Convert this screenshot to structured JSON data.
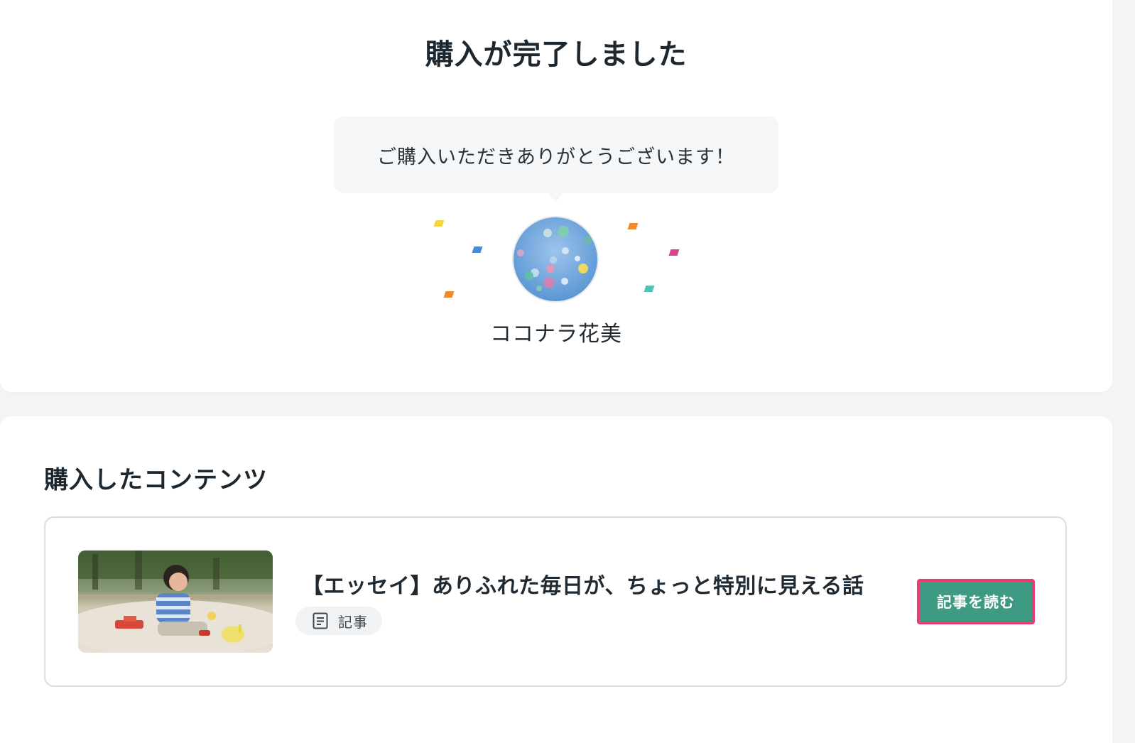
{
  "header": {
    "title": "購入が完了しました"
  },
  "thanks": {
    "message": "ご購入いただきありがとうございます！"
  },
  "author": {
    "name": "ココナラ花美",
    "avatar_icon": "balloons-photo"
  },
  "confetti_colors": [
    "#f5d63c",
    "#3f8fe0",
    "#ee8c2a",
    "#ef8a2e",
    "#d9448c",
    "#4fc4b2"
  ],
  "purchased": {
    "section_title": "購入したコンテンツ",
    "items": [
      {
        "title": "【エッセイ】ありふれた毎日が、ちょっと特別に見える話",
        "type_label": "記事",
        "type_icon": "document-icon",
        "thumbnail": "child-in-sandbox-photo",
        "button_label": "記事を読む"
      }
    ]
  },
  "colors": {
    "button": "#3e9b83",
    "button_highlight": "#e63c73",
    "background": "#f3f4f5"
  }
}
